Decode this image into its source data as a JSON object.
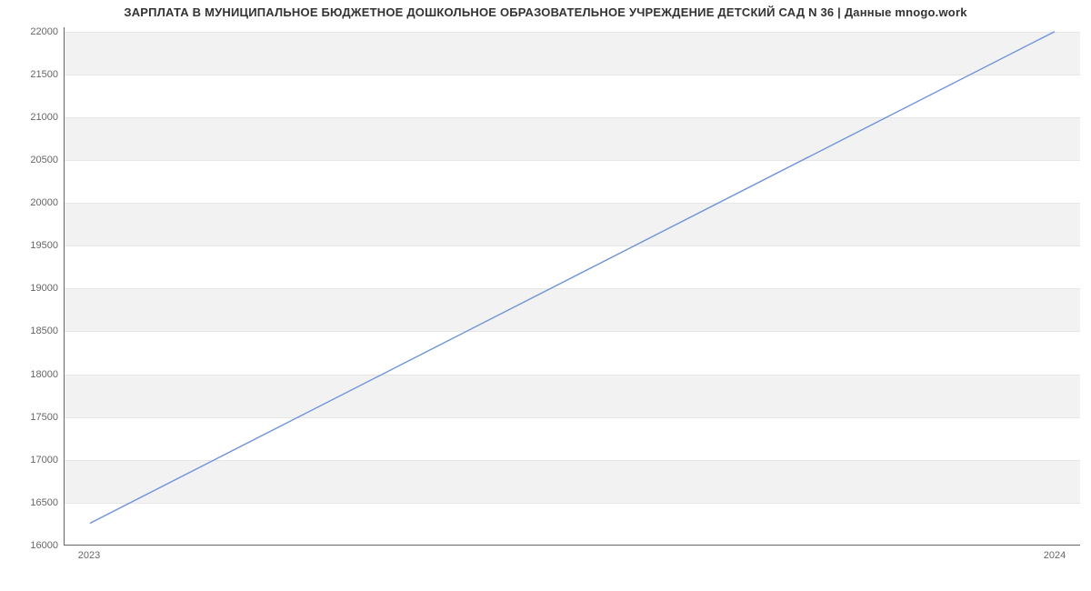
{
  "chart_data": {
    "type": "line",
    "title": "ЗАРПЛАТА В МУНИЦИПАЛЬНОЕ БЮДЖЕТНОЕ ДОШКОЛЬНОЕ ОБРАЗОВАТЕЛЬНОЕ УЧРЕЖДЕНИЕ ДЕТСКИЙ САД N 36 | Данные mnogo.work",
    "xlabel": "",
    "ylabel": "",
    "x_categories": [
      "2023",
      "2024"
    ],
    "series": [
      {
        "name": "Зарплата",
        "values": [
          16250,
          22000
        ]
      }
    ],
    "y_ticks": [
      16000,
      16500,
      17000,
      17500,
      18000,
      18500,
      19000,
      19500,
      20000,
      20500,
      21000,
      21500,
      22000
    ],
    "ylim": [
      16000,
      22050
    ],
    "line_color": "#6f94d8",
    "band_color": "#f2f2f2"
  }
}
